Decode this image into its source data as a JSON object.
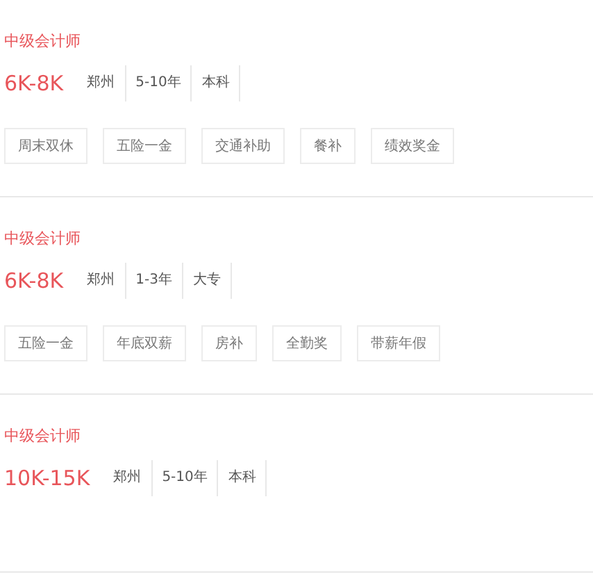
{
  "jobs": [
    {
      "title": "中级会计师",
      "salary": "6K-8K",
      "meta": [
        "郑州",
        "5-10年",
        "本科"
      ],
      "tags": [
        "周末双休",
        "五险一金",
        "交通补助",
        "餐补",
        "绩效奖金"
      ]
    },
    {
      "title": "中级会计师",
      "salary": "6K-8K",
      "meta": [
        "郑州",
        "1-3年",
        "大专"
      ],
      "tags": [
        "五险一金",
        "年底双薪",
        "房补",
        "全勤奖",
        "带薪年假"
      ]
    },
    {
      "title": "中级会计师",
      "salary": "10K-15K",
      "meta": [
        "郑州",
        "5-10年",
        "本科"
      ]
    }
  ]
}
